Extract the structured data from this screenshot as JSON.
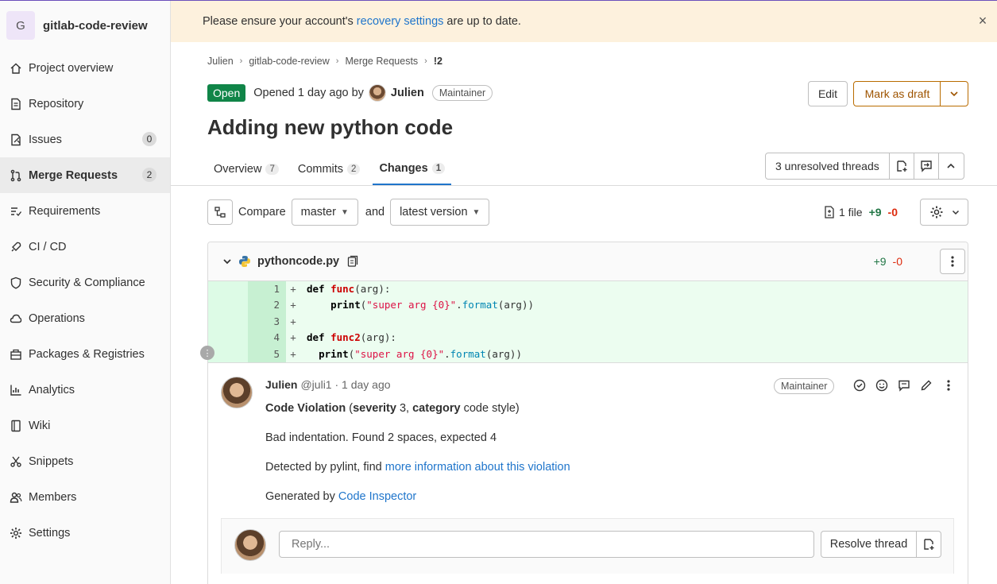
{
  "project": {
    "avatar_letter": "G",
    "name": "gitlab-code-review"
  },
  "sidebar": {
    "items": [
      {
        "label": "Project overview",
        "icon": "home-icon"
      },
      {
        "label": "Repository",
        "icon": "doc-icon"
      },
      {
        "label": "Issues",
        "icon": "issues-icon",
        "badge": "0"
      },
      {
        "label": "Merge Requests",
        "icon": "merge-request-icon",
        "badge": "2",
        "active": true
      },
      {
        "label": "Requirements",
        "icon": "requirements-icon"
      },
      {
        "label": "CI / CD",
        "icon": "rocket-icon"
      },
      {
        "label": "Security & Compliance",
        "icon": "shield-icon"
      },
      {
        "label": "Operations",
        "icon": "cloud-icon"
      },
      {
        "label": "Packages & Registries",
        "icon": "package-icon"
      },
      {
        "label": "Analytics",
        "icon": "chart-icon"
      },
      {
        "label": "Wiki",
        "icon": "book-icon"
      },
      {
        "label": "Snippets",
        "icon": "scissors-icon"
      },
      {
        "label": "Members",
        "icon": "users-icon"
      },
      {
        "label": "Settings",
        "icon": "gear-icon"
      }
    ]
  },
  "banner": {
    "prefix": "Please ensure your account's ",
    "link": "recovery settings",
    "suffix": " are up to date.",
    "close": "×"
  },
  "breadcrumb": [
    "Julien",
    "gitlab-code-review",
    "Merge Requests",
    "!2"
  ],
  "mr": {
    "status": "Open",
    "opened_text": "Opened 1 day ago by",
    "author": "Julien",
    "role": "Maintainer",
    "title": "Adding new python code",
    "edit_label": "Edit",
    "draft_label": "Mark as draft"
  },
  "tabs": [
    {
      "label": "Overview",
      "count": "7"
    },
    {
      "label": "Commits",
      "count": "2"
    },
    {
      "label": "Changes",
      "count": "1",
      "active": true
    }
  ],
  "threads": {
    "label": "3 unresolved threads"
  },
  "compare": {
    "label": "Compare",
    "base": "master",
    "and": "and",
    "version": "latest version",
    "files": "1 file",
    "additions": "+9",
    "deletions": "-0"
  },
  "file": {
    "name": "pythoncode.py",
    "additions": "+9",
    "deletions": "-0",
    "lines": [
      {
        "n": "1",
        "sign": "+",
        "tokens": [
          [
            "kw",
            "def "
          ],
          [
            "fn",
            "func"
          ],
          [
            "",
            "(arg):"
          ]
        ]
      },
      {
        "n": "2",
        "sign": "+",
        "tokens": [
          [
            "",
            "    "
          ],
          [
            "kw",
            "print"
          ],
          [
            "",
            "("
          ],
          [
            "str",
            "\"super arg {0}\""
          ],
          [
            "",
            "."
          ],
          [
            "mth",
            "format"
          ],
          [
            "",
            "(arg))"
          ]
        ]
      },
      {
        "n": "3",
        "sign": "+",
        "tokens": []
      },
      {
        "n": "4",
        "sign": "+",
        "tokens": [
          [
            "kw",
            "def "
          ],
          [
            "fn",
            "func2"
          ],
          [
            "",
            "(arg):"
          ]
        ]
      },
      {
        "n": "5",
        "sign": "+",
        "tokens": [
          [
            "",
            "  "
          ],
          [
            "kw",
            "print"
          ],
          [
            "",
            "("
          ],
          [
            "str",
            "\"super arg {0}\""
          ],
          [
            "",
            "."
          ],
          [
            "mth",
            "format"
          ],
          [
            "",
            "(arg))"
          ]
        ]
      }
    ]
  },
  "note": {
    "author": "Julien",
    "meta": "@juli1 · 1 day ago",
    "role": "Maintainer",
    "violation_title": "Code Violation",
    "severity_label": "severity",
    "severity_value": "3",
    "category_label": "category",
    "category_value": "code style",
    "message": "Bad indentation. Found 2 spaces, expected 4",
    "detected_prefix": "Detected by pylint, find ",
    "detected_link": "more information about this violation",
    "generated_prefix": "Generated by ",
    "generated_link": "Code Inspector"
  },
  "reply": {
    "placeholder": "Reply...",
    "resolve_label": "Resolve thread"
  }
}
